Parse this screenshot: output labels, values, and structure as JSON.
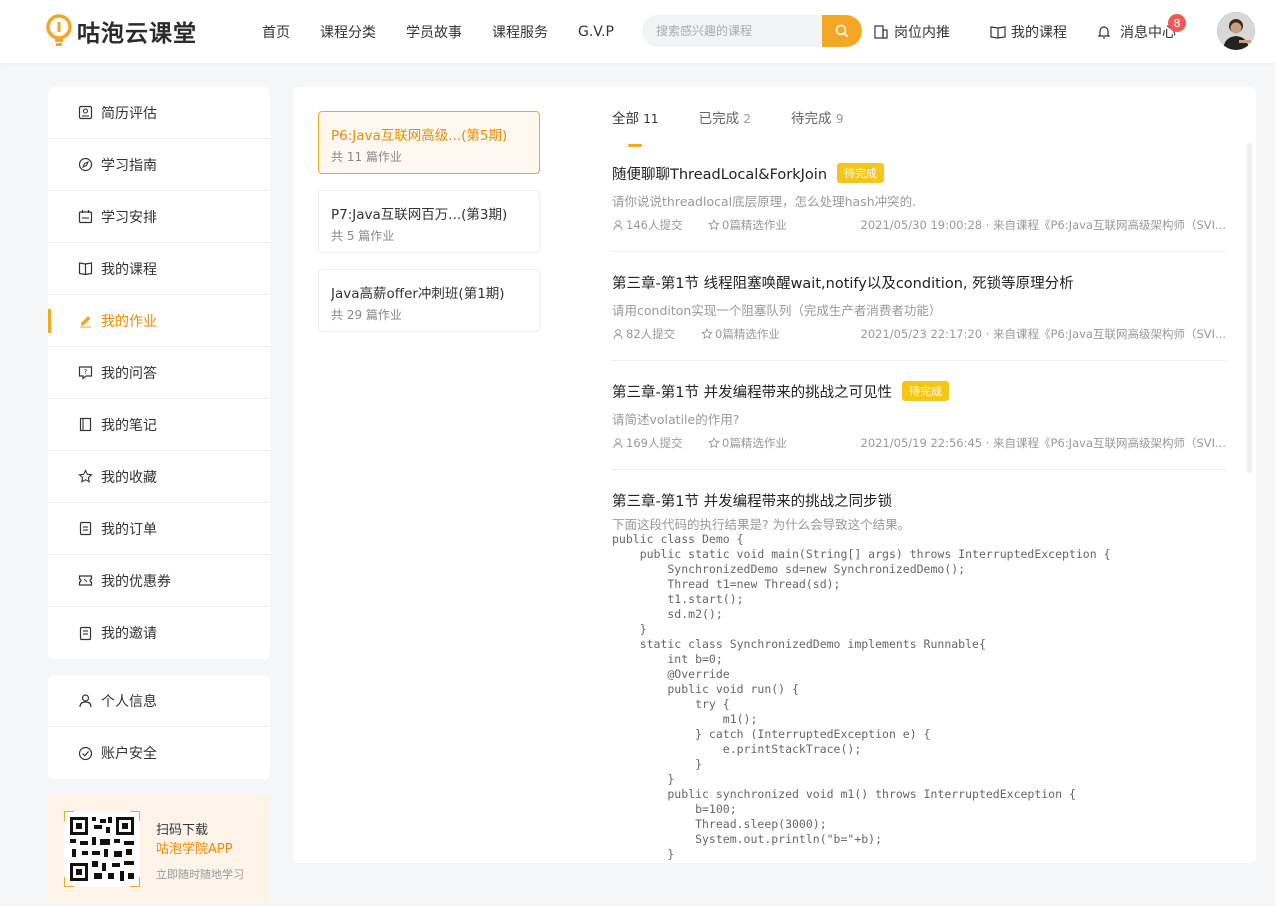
{
  "header": {
    "logo_text": "咕泡云课堂",
    "nav": [
      "首页",
      "课程分类",
      "学员故事",
      "课程服务",
      "G.V.P"
    ],
    "search_placeholder": "搜索感兴趣的课程",
    "job_link": "岗位内推",
    "my_courses_link": "我的课程",
    "messages_link": "消息中心",
    "messages_badge": "8"
  },
  "sidebar": {
    "group1": [
      {
        "label": "简历评估",
        "icon": "resume-icon"
      },
      {
        "label": "学习指南",
        "icon": "compass-icon"
      },
      {
        "label": "学习安排",
        "icon": "calendar-icon"
      },
      {
        "label": "我的课程",
        "icon": "book-icon"
      },
      {
        "label": "我的作业",
        "icon": "pencil-icon",
        "active": true
      },
      {
        "label": "我的问答",
        "icon": "question-icon"
      },
      {
        "label": "我的笔记",
        "icon": "notebook-icon"
      },
      {
        "label": "我的收藏",
        "icon": "star-icon"
      },
      {
        "label": "我的订单",
        "icon": "order-icon"
      },
      {
        "label": "我的优惠券",
        "icon": "coupon-icon"
      },
      {
        "label": "我的邀请",
        "icon": "invite-icon"
      }
    ],
    "group2": [
      {
        "label": "个人信息",
        "icon": "user-icon"
      },
      {
        "label": "账户安全",
        "icon": "shield-check-icon"
      }
    ],
    "app": {
      "line1": "扫码下载",
      "line2": "咕泡学院APP",
      "line3": "立即随时随地学习"
    }
  },
  "courses": [
    {
      "title": "P6:Java互联网高级...(第5期)",
      "count": "共 11 篇作业",
      "active": true
    },
    {
      "title": "P7:Java互联网百万...(第3期)",
      "count": "共 5 篇作业"
    },
    {
      "title": "Java高薪offer冲刺班(第1期)",
      "count": "共 29 篇作业"
    }
  ],
  "tabs": [
    {
      "label": "全部",
      "count": "11",
      "active": true
    },
    {
      "label": "已完成",
      "count": "2"
    },
    {
      "label": "待完成",
      "count": "9"
    }
  ],
  "homework": [
    {
      "title": "随便聊聊ThreadLocal&ForkJoin",
      "status": "待完成",
      "desc": "请你说说threadlocal底层原理，怎么处理hash冲突的.",
      "submits": "146人提交",
      "featured": "0篇精选作业",
      "meta": "2021/05/30 19:00:28 · 来自课程《P6:Java互联网高级架构师（SVI..."
    },
    {
      "title": "第三章-第1节 线程阻塞唤醒wait,notify以及condition, 死锁等原理分析",
      "status": "",
      "desc": "请用conditon实现一个阻塞队列（完成生产者消费者功能）",
      "submits": "82人提交",
      "featured": "0篇精选作业",
      "meta": "2021/05/23 22:17:20 · 来自课程《P6:Java互联网高级架构师（SVI..."
    },
    {
      "title": "第三章-第1节 并发编程带来的挑战之可见性",
      "status": "待完成",
      "desc": "请简述volatile的作用?",
      "submits": "169人提交",
      "featured": "0篇精选作业",
      "meta": "2021/05/19 22:56:45 · 来自课程《P6:Java互联网高级架构师（SVI..."
    },
    {
      "title": "第三章-第1节 并发编程带来的挑战之同步锁",
      "status": "",
      "desc": "下面这段代码的执行结果是? 为什么会导致这个结果。",
      "code": "public class Demo {\n    public static void main(String[] args) throws InterruptedException {\n        SynchronizedDemo sd=new SynchronizedDemo();\n        Thread t1=new Thread(sd);\n        t1.start();\n        sd.m2();\n    }\n    static class SynchronizedDemo implements Runnable{\n        int b=0;\n        @Override\n        public void run() {\n            try {\n                m1();\n            } catch (InterruptedException e) {\n                e.printStackTrace();\n            }\n        }\n        public synchronized void m1() throws InterruptedException {\n            b=100;\n            Thread.sleep(3000);\n            System.out.println(\"b=\"+b);\n        }"
    }
  ],
  "colors": {
    "accent": "#f5a623",
    "active_text": "#f08a00",
    "badge": "#f25a5a",
    "pending": "#f5c518"
  }
}
